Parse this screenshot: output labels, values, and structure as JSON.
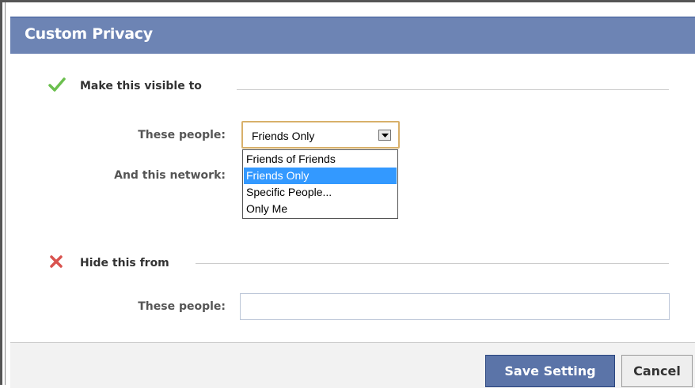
{
  "dialog": {
    "title": "Custom Privacy",
    "visible_section": {
      "heading": "Make this visible to",
      "icon": "check-icon",
      "these_people_label": "These people:",
      "these_people_value": "Friends Only",
      "network_label": "And this network:",
      "dropdown_options": [
        "Friends of Friends",
        "Friends Only",
        "Specific People...",
        "Only Me"
      ],
      "highlighted_option": "Friends Only"
    },
    "hide_section": {
      "heading": "Hide this from",
      "icon": "x-icon",
      "these_people_label": "These people:",
      "these_people_value": ""
    },
    "buttons": {
      "save": "Save Setting",
      "cancel": "Cancel"
    }
  },
  "colors": {
    "title_bar": "#6d84b4",
    "primary_button": "#5b74a8",
    "highlight": "#3399ff",
    "check": "#6bbf4e",
    "x": "#d9534f"
  }
}
